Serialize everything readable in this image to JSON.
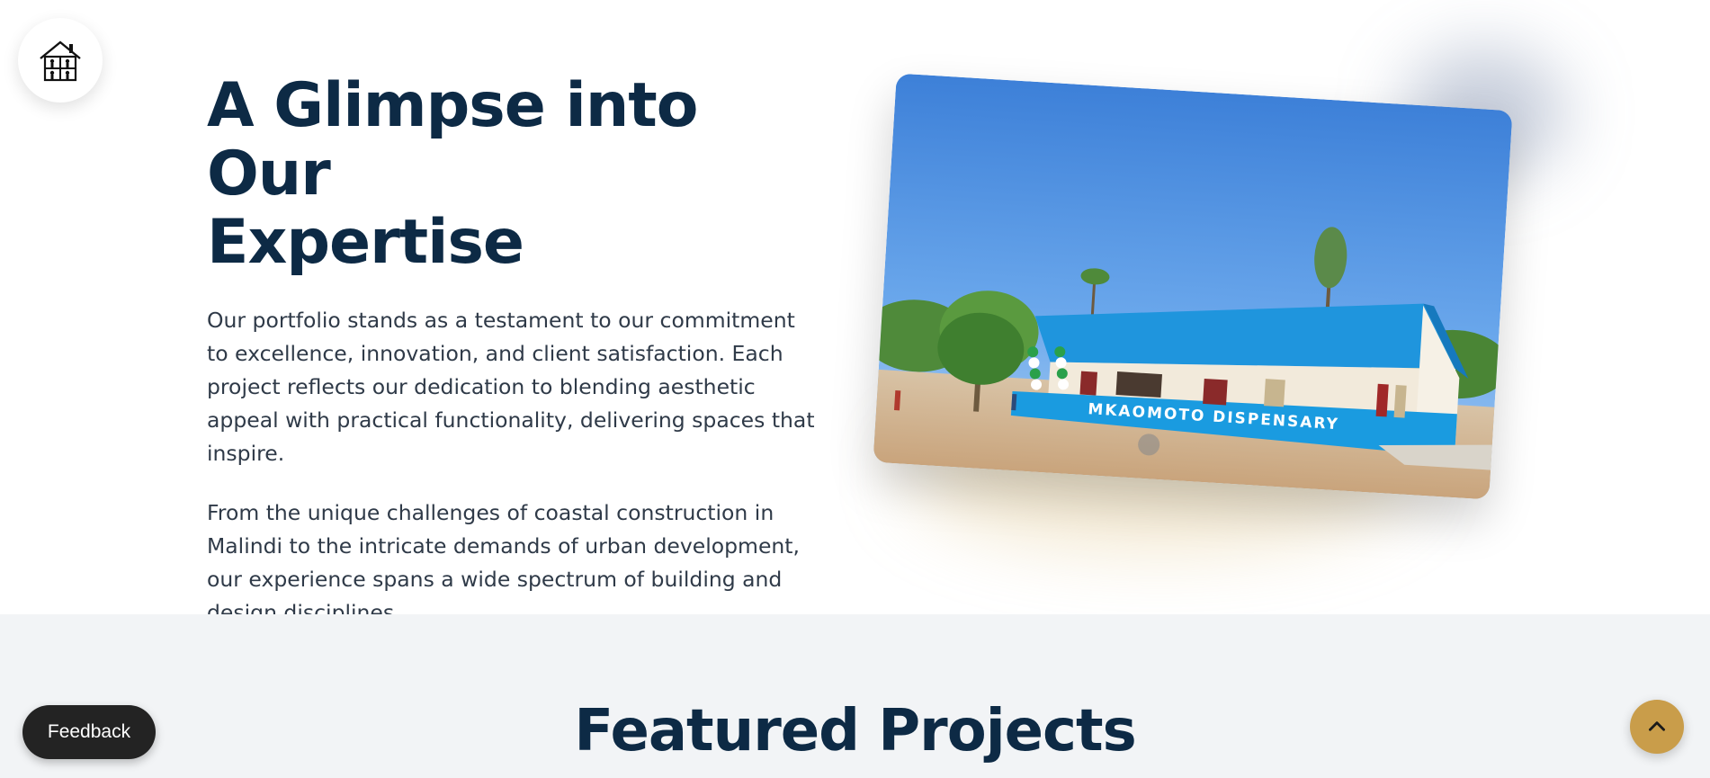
{
  "logo": {
    "icon": "house-logo-icon"
  },
  "hero": {
    "title_line1": "A Glimpse into Our",
    "title_line2": "Expertise",
    "paragraph1": "Our portfolio stands as a testament to our commitment to excellence, innovation, and client satisfaction. Each project reflects our dedication to blending aesthetic appeal with practical functionality, delivering spaces that inspire.",
    "paragraph2": "From the unique challenges of coastal construction in Malindi to the intricate demands of urban development, our experience spans a wide spectrum of building and design disciplines.",
    "photo": {
      "sign_text": "MKAOMOTO  DISPENSARY",
      "accent_blue": "#1a9be0",
      "sky_blue": "#3d8be0"
    }
  },
  "featured": {
    "title": "Featured Projects"
  },
  "feedback": {
    "label": "Feedback"
  },
  "scroll_top": {
    "icon": "chevron-up-icon",
    "color": "#c99d4a"
  },
  "colors": {
    "heading": "#0d2a45",
    "body_text": "#2f3a48",
    "section_bg": "#f2f4f6"
  }
}
